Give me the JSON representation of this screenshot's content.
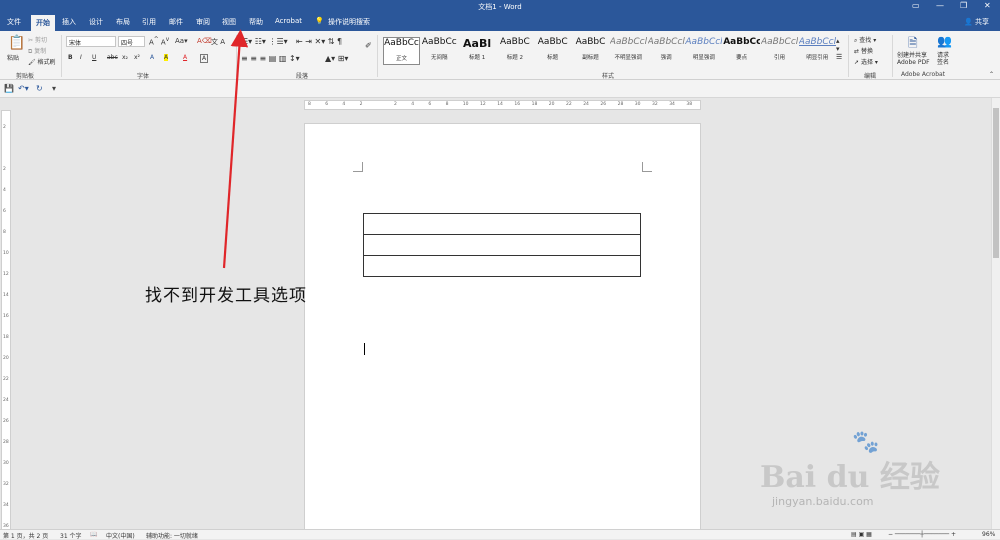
{
  "window": {
    "title": "文档1 - Word",
    "controls": [
      "▭",
      "—",
      "❐",
      "✕"
    ]
  },
  "tabs": {
    "items": [
      "文件",
      "开始",
      "插入",
      "设计",
      "布局",
      "引用",
      "邮件",
      "审阅",
      "视图",
      "帮助",
      "Acrobat"
    ],
    "active": "开始",
    "tell_me": "操作说明搜索",
    "share": "共享"
  },
  "ribbon": {
    "clipboard": {
      "label": "剪贴板",
      "paste": "粘贴",
      "cut": "剪切",
      "copy": "复制",
      "format_painter": "格式刷"
    },
    "font": {
      "label": "字体",
      "font_name": "宋体",
      "font_size": "四号",
      "buttons": [
        "B",
        "I",
        "U",
        "abc",
        "x₂",
        "x²",
        "A",
        "A",
        "A",
        "A"
      ]
    },
    "paragraph": {
      "label": "段落"
    },
    "styles": {
      "label": "样式",
      "items": [
        {
          "sample": "AaBbCc",
          "name": "正文"
        },
        {
          "sample": "AaBbCc",
          "name": "无间隔"
        },
        {
          "sample": "AaBl",
          "name": "标题 1"
        },
        {
          "sample": "AaBbC",
          "name": "标题 2"
        },
        {
          "sample": "AaBbC",
          "name": "标题"
        },
        {
          "sample": "AaBbC",
          "name": "副标题"
        },
        {
          "sample": "AaBbCcl",
          "name": "不明显强调"
        },
        {
          "sample": "AaBbCcl",
          "name": "强调"
        },
        {
          "sample": "AaBbCcl",
          "name": "明显强调"
        },
        {
          "sample": "AaBbCcl",
          "name": "要点"
        },
        {
          "sample": "AaBbCcl",
          "name": "引用"
        },
        {
          "sample": "AaBbCcl",
          "name": "明显引用"
        }
      ]
    },
    "editing": {
      "label": "编辑",
      "find": "查找",
      "replace": "替换",
      "select": "选择"
    },
    "acrobat": {
      "label": "Adobe Acrobat",
      "create_share_line1": "创建并共享",
      "create_share_line2": "Adobe PDF",
      "request_sign_line1": "请求",
      "request_sign_line2": "签名"
    }
  },
  "ruler": {
    "h_ticks": [
      "8",
      "6",
      "4",
      "2",
      "",
      "2",
      "4",
      "6",
      "8",
      "10",
      "12",
      "14",
      "16",
      "18",
      "20",
      "22",
      "24",
      "26",
      "28",
      "30",
      "32",
      "34",
      "38"
    ],
    "v_ticks": [
      "2",
      "",
      "2",
      "4",
      "6",
      "8",
      "10",
      "12",
      "14",
      "16",
      "18",
      "20",
      "22",
      "24",
      "26",
      "28",
      "30",
      "32",
      "34",
      "36"
    ]
  },
  "document": {
    "table_rows": 3
  },
  "annotation": {
    "callout_text": "找不到开发工具选项",
    "arrow_color": "#e0262a"
  },
  "status": {
    "page": "第 1 页，共 2 页",
    "words": "31 个字",
    "language": "中文(中国)",
    "accessibility": "辅助功能: 一切就绪",
    "zoom": "96%"
  },
  "watermark": {
    "logo": "Bai du 经验",
    "url": "jingyan.baidu.com"
  },
  "colors": {
    "accent": "#2b579a"
  }
}
